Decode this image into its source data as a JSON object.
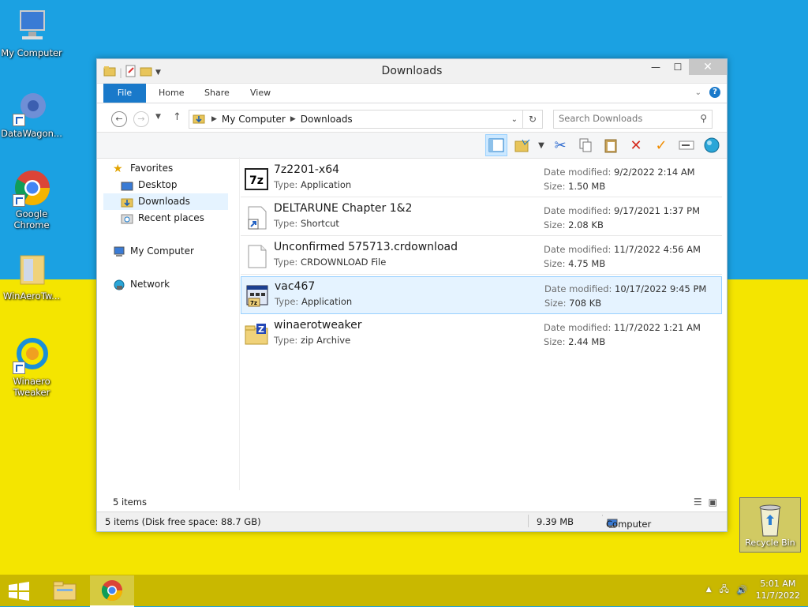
{
  "desktop": {
    "icons": [
      {
        "label": "My Computer"
      },
      {
        "label": "DataWagon..."
      },
      {
        "label": "Google Chrome"
      },
      {
        "label": "WinAeroTw..."
      },
      {
        "label": "Winaero Tweaker"
      }
    ],
    "recycle_bin": "Recycle Bin"
  },
  "window": {
    "title": "Downloads",
    "tabs": {
      "file": "File",
      "home": "Home",
      "share": "Share",
      "view": "View"
    },
    "address": {
      "root": "My Computer",
      "current": "Downloads"
    },
    "search_placeholder": "Search Downloads",
    "nav": {
      "favorites": "Favorites",
      "desktop": "Desktop",
      "downloads": "Downloads",
      "recent": "Recent places",
      "computer": "My Computer",
      "network": "Network"
    },
    "labels": {
      "type": "Type:",
      "date": "Date modified:",
      "size": "Size:"
    },
    "files": [
      {
        "name": "7z2201-x64",
        "type": "Application",
        "date": "9/2/2022 2:14 AM",
        "size": "1.50 MB"
      },
      {
        "name": "DELTARUNE Chapter 1&2",
        "type": "Shortcut",
        "date": "9/17/2021 1:37 PM",
        "size": "2.08 KB"
      },
      {
        "name": "Unconfirmed 575713.crdownload",
        "type": "CRDOWNLOAD File",
        "date": "11/7/2022 4:56 AM",
        "size": "4.75 MB"
      },
      {
        "name": "vac467",
        "type": "Application",
        "date": "10/17/2022 9:45 PM",
        "size": "708 KB"
      },
      {
        "name": "winaerotweaker",
        "type": "zip Archive",
        "date": "11/7/2022 1:21 AM",
        "size": "2.44 MB"
      }
    ],
    "item_count": "5 items",
    "status": {
      "left": "5 items (Disk free space: 88.7 GB)",
      "size": "9.39 MB",
      "location": "Computer"
    }
  },
  "taskbar": {
    "time": "5:01 AM",
    "date": "11/7/2022"
  },
  "colors": {
    "accent": "#1979ca",
    "desktop_top": "#1ba1e2",
    "desktop_bottom": "#f4e500",
    "selection": "#e5f3ff"
  }
}
